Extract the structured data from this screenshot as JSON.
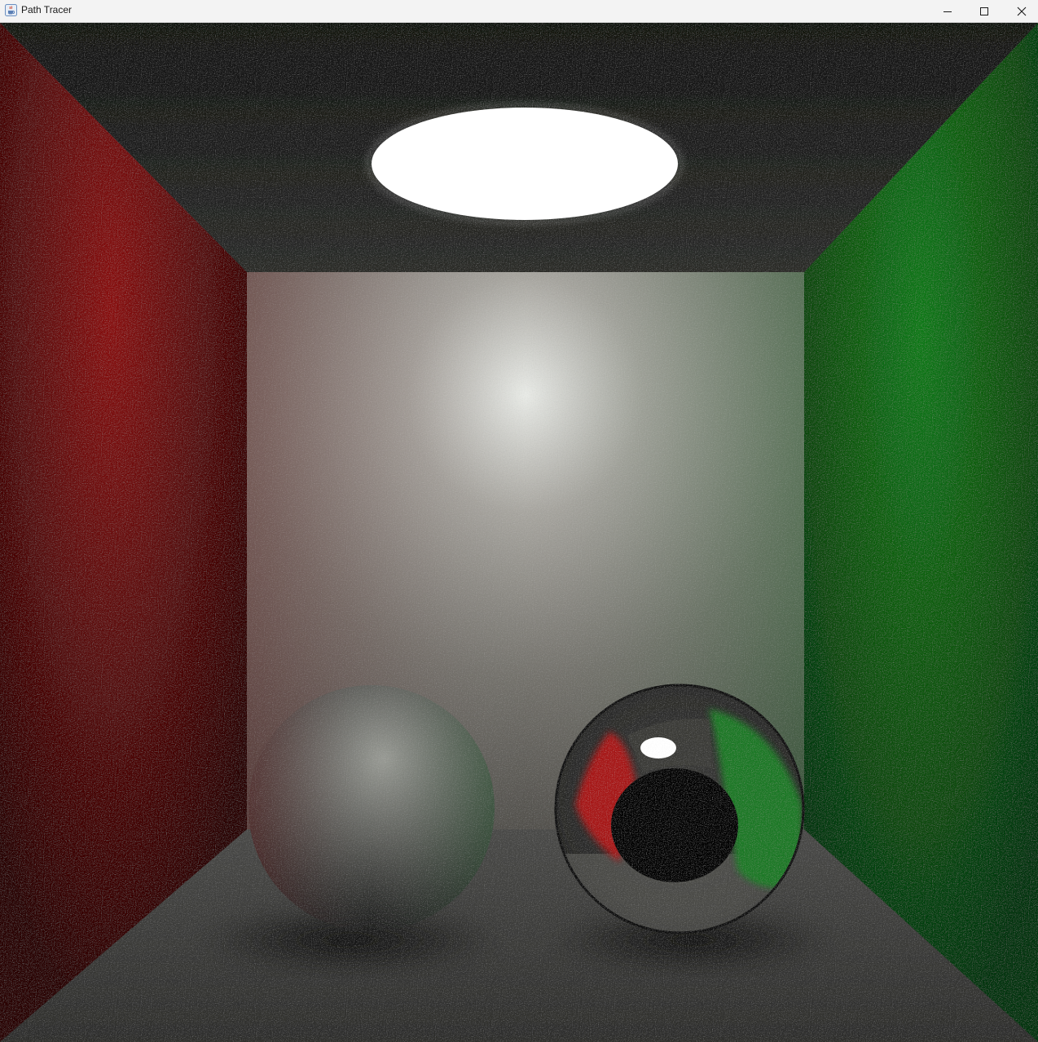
{
  "window": {
    "title": "Path Tracer",
    "app_icon": "java-cup-icon",
    "controls": {
      "minimize_icon": "minimize-icon",
      "maximize_icon": "maximize-icon",
      "close_icon": "close-icon"
    }
  },
  "scene": {
    "left_wall_color": "#7a0a0a",
    "right_wall_color": "#0c6a12",
    "back_wall_color": "#8a8a82",
    "ceiling_color": "#1e1f1c",
    "floor_color": "#3a3a38",
    "light_color": "#ffffff"
  }
}
